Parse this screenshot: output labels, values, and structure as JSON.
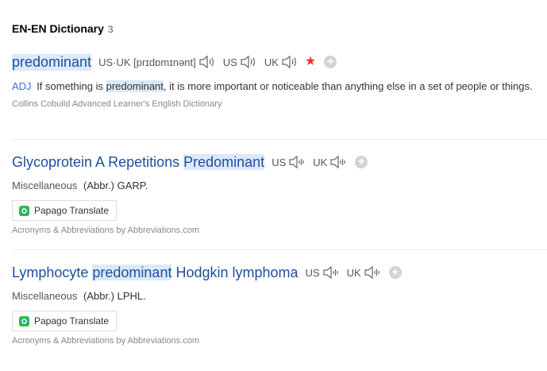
{
  "header": {
    "title": "EN-EN Dictionary",
    "count": "3"
  },
  "entry1": {
    "word": "predominant",
    "pron": "US·UK [prɪdɒmɪnənt]",
    "us": "US",
    "uk": "UK",
    "pos": "ADJ",
    "def_before": "If something is ",
    "def_highlight": "predominant",
    "def_after": ", it is more important or noticeable than anything else in a set of people or things.",
    "source": "Collins Cobuild Advanced Learner's English Dictionary",
    "star_color": "#e8362a"
  },
  "entry2": {
    "word_pre": "Glycoprotein A Repetitions ",
    "word_hl": "Predominant",
    "us": "US",
    "uk": "UK",
    "category": "Miscellaneous",
    "abbr": "(Abbr.) GARP.",
    "translate": "Papago Translate",
    "source": "Acronyms & Abbreviations by Abbreviations.com"
  },
  "entry3": {
    "word_pre": "Lymphocyte ",
    "word_hl": "predominant",
    "word_post": " Hodgkin lymphoma",
    "us": "US",
    "uk": "UK",
    "category": "Miscellaneous",
    "abbr": "(Abbr.) LPHL.",
    "translate": "Papago Translate",
    "source": "Acronyms & Abbreviations by Abbreviations.com"
  },
  "colors": {
    "link": "#1f4e9c",
    "highlight": "#dce9f8",
    "pos": "#3a6fd0"
  }
}
